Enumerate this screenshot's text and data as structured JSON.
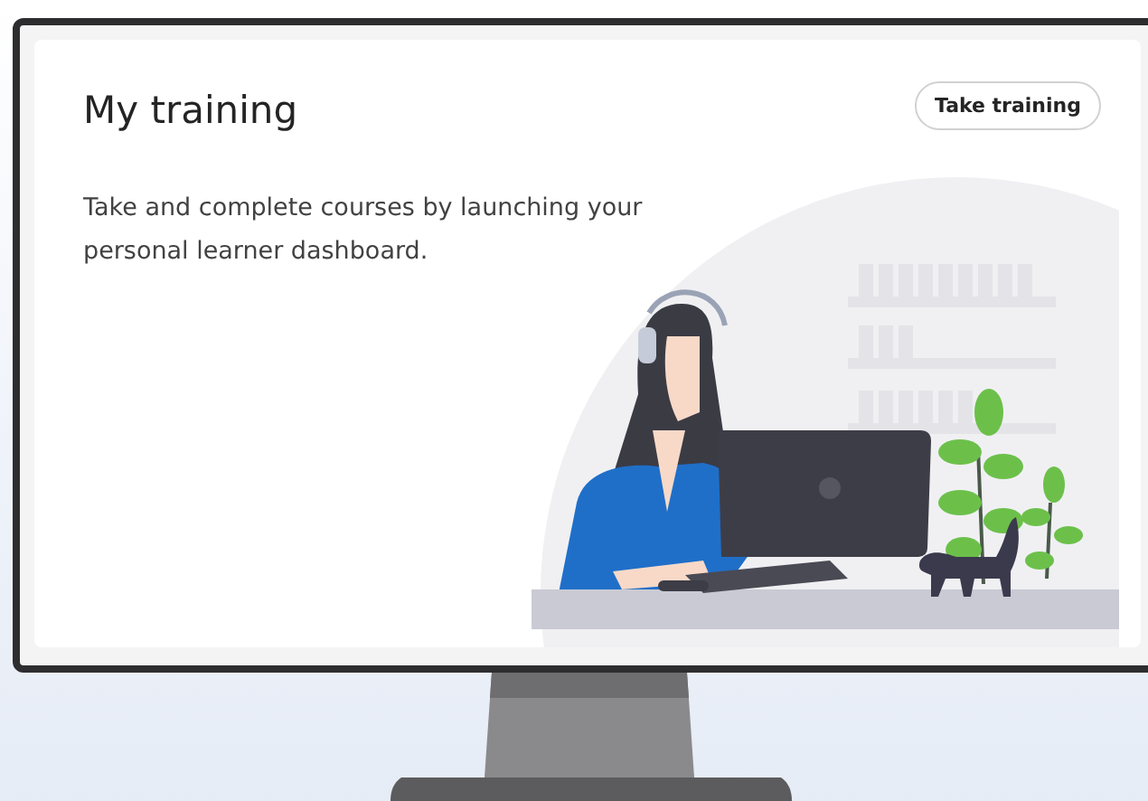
{
  "card": {
    "title": "My training",
    "description": "Take and complete courses by launching your personal learner dashboard.",
    "button": "Take training"
  }
}
